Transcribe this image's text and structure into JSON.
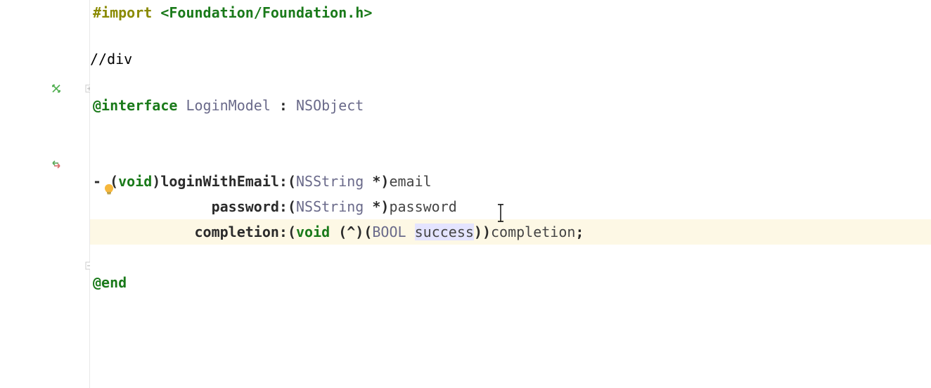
{
  "colors": {
    "highlight_bg": "#fdf8e5",
    "selection_bg": "#e4e4ff",
    "keyword_green": "#1a7a1a",
    "type_gray": "#6a6a8a",
    "import_olive": "#8a8a00"
  },
  "gutter": {
    "icon_line4": "navigate-icon",
    "icon_line7": "swap-icon",
    "icon_line8_bulb": "intention-bulb-icon",
    "fold_start_line4": true,
    "fold_end_line11": true
  },
  "code": {
    "l1_import": "#import",
    "l1_sp": " ",
    "l1_header": "<Foundation/Foundation.h>",
    "l4_at_interface": "@interface",
    "l4_sp1": " ",
    "l4_classname": "LoginModel",
    "l4_sp2": " : ",
    "l4_super": "NSObject",
    "l7_dash": "- (",
    "l7_void": "void",
    "l7_close1": ")",
    "l7_sel1": "loginWithEmail:",
    "l7_open2": "(",
    "l7_nsstring1": "NSString",
    "l7_star1": " *)",
    "l7_email": "email",
    "l8_indent": "              ",
    "l8_sel2": "password:",
    "l8_open": "(",
    "l8_nsstring2": "NSString",
    "l8_star2": " *)",
    "l8_password": "password",
    "l9_indent": "            ",
    "l9_sel3": "completion:",
    "l9_open": "(",
    "l9_void": "void",
    "l9_block": " (^)(",
    "l9_bool": "BOOL",
    "l9_sp": " ",
    "l9_success": "success",
    "l9_close": "))",
    "l9_completion": "completion",
    "l9_semi": ";",
    "l11_end": "@end"
  },
  "cursor": {
    "line": 9,
    "identifier": "success",
    "position_in_word": 3
  }
}
